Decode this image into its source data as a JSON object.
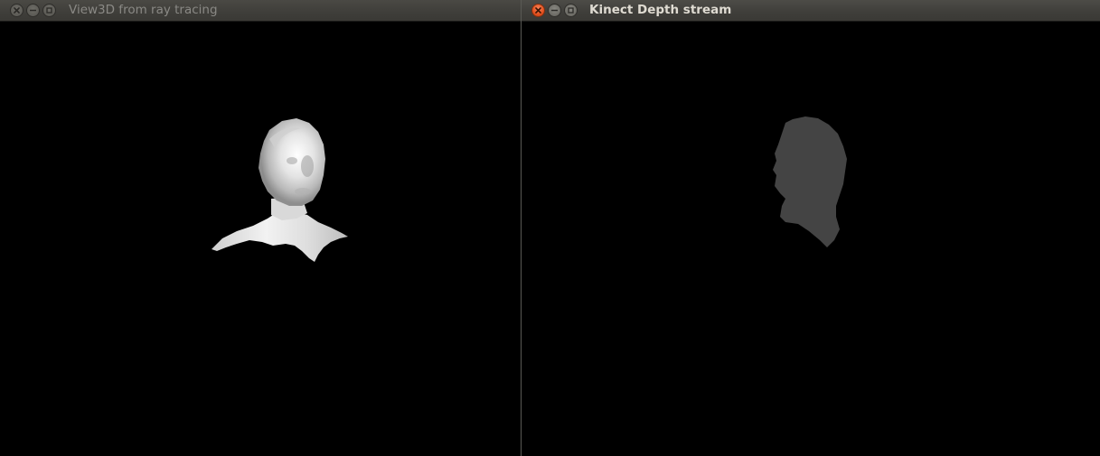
{
  "windows": [
    {
      "title": "View3D from ray tracing",
      "state": "inactive",
      "content": "3D ray-traced render of head and shoulders",
      "colors": {
        "render_highlight": "#f2f2f2",
        "render_shadow": "#9a9a9a"
      }
    },
    {
      "title": "Kinect Depth stream",
      "state": "active",
      "content": "Depth map silhouette of head",
      "colors": {
        "silhouette": "#434343"
      }
    }
  ],
  "window_buttons": [
    "close-icon",
    "minimize-icon",
    "maximize-icon"
  ],
  "colors": {
    "background": "#000000",
    "titlebar": "#3f3e3a",
    "close_active": "#e2501f"
  }
}
